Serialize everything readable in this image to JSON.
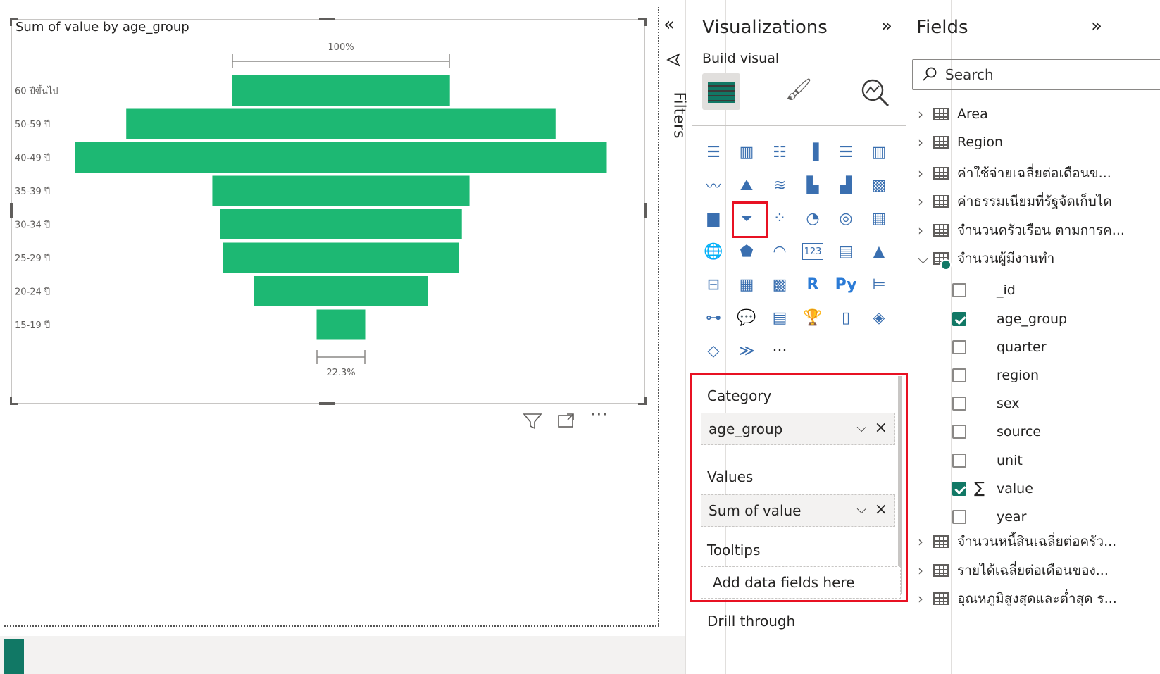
{
  "visual": {
    "title": "Sum of value by age_group",
    "top_label": "100%",
    "bottom_label": "22.3%"
  },
  "chart_data": {
    "type": "funnel",
    "title": "Sum of value by age_group",
    "categories": [
      "60 ปีขึ้นไป",
      "50-59 ปี",
      "40-49 ปี",
      "35-39 ปี",
      "30-34 ปี",
      "25-29 ปี",
      "20-24 ปี",
      "15-19 ปี"
    ],
    "values": [
      100,
      197,
      244,
      118,
      111,
      108,
      80,
      22.3
    ],
    "bar_color": "#1db873",
    "annotations": [
      "100%",
      "22.3%"
    ]
  },
  "filters": {
    "label": "Filters",
    "collapse_icon": "double-chevron-left-icon"
  },
  "visualizations": {
    "title": "Visualizations",
    "build_visual": "Build visual",
    "wells": {
      "category_label": "Category",
      "category_value": "age_group",
      "values_label": "Values",
      "values_value": "Sum of value",
      "tooltips_label": "Tooltips",
      "tooltips_placeholder": "Add data fields here",
      "drill_label": "Drill through"
    },
    "more": "···"
  },
  "fields": {
    "title": "Fields",
    "search_placeholder": "Search",
    "tables": [
      {
        "name": "Area"
      },
      {
        "name": "Region"
      },
      {
        "name": "ค่าใช้จ่ายเฉลี่ยต่อเดือนข..."
      },
      {
        "name": "ค่าธรรมเนียมที่รัฐจัดเก็บได"
      },
      {
        "name": "จำนวนครัวเรือน ตามการค..."
      },
      {
        "name": "จำนวนผู้มีงานทำ"
      }
    ],
    "columns": [
      {
        "name": "_id",
        "checked": false
      },
      {
        "name": "age_group",
        "checked": true
      },
      {
        "name": "quarter",
        "checked": false
      },
      {
        "name": "region",
        "checked": false
      },
      {
        "name": "sex",
        "checked": false
      },
      {
        "name": "source",
        "checked": false
      },
      {
        "name": "unit",
        "checked": false
      },
      {
        "name": "value",
        "checked": true
      },
      {
        "name": "year",
        "checked": false
      }
    ],
    "tables_after": [
      {
        "name": "จำนวนหนี้สินเฉลี่ยต่อครัว..."
      },
      {
        "name": "รายได้เฉลี่ยต่อเดือนของ..."
      },
      {
        "name": "อุณหภูมิสูงสุดและต่ำสุด ร..."
      }
    ]
  }
}
